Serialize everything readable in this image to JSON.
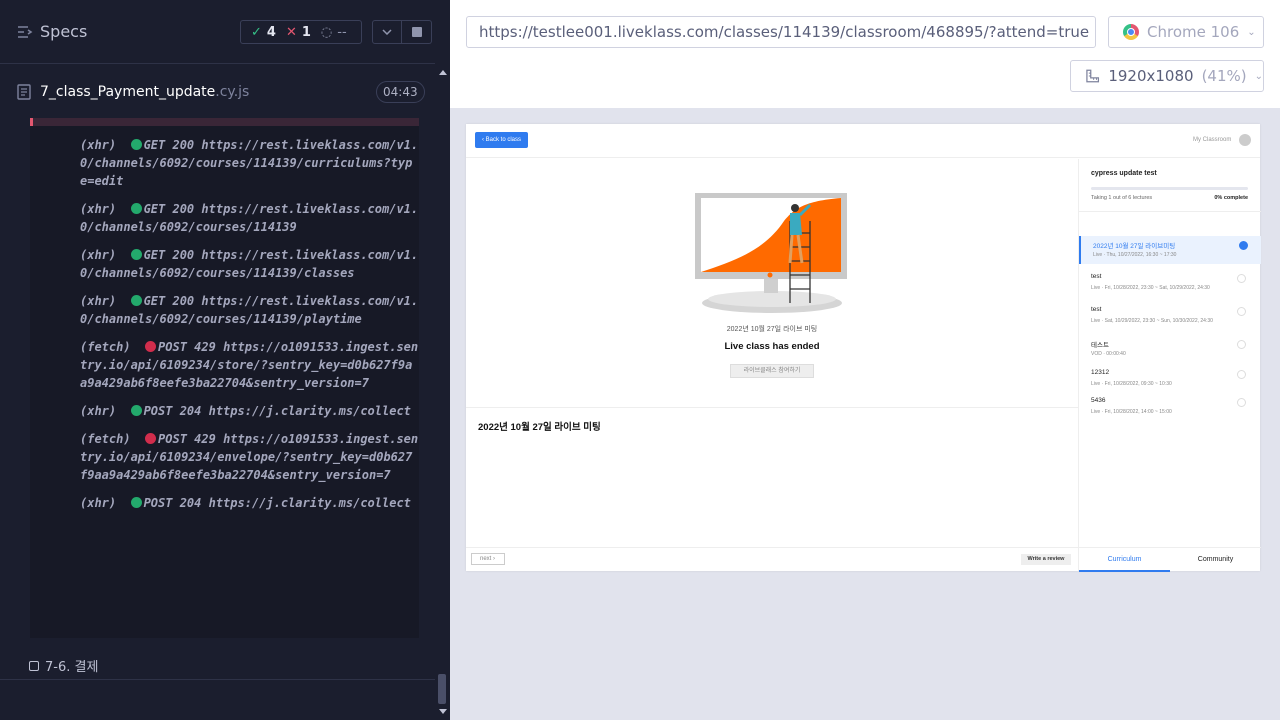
{
  "runner": {
    "specs_title": "Specs",
    "stats": {
      "passed": "4",
      "failed": "1",
      "pending": "--"
    },
    "file": {
      "name": "7_class_Payment_update",
      "ext": ".cy.js",
      "time": "04:43"
    },
    "log": [
      {
        "kind": "(xhr)",
        "status": "ok",
        "method": "GET 200",
        "url": "https://rest.liveklass.com/v1.0/channels/6092/courses/114139/curriculums?type=edit"
      },
      {
        "kind": "(xhr)",
        "status": "ok",
        "method": "GET 200",
        "url": "https://rest.liveklass.com/v1.0/channels/6092/courses/114139"
      },
      {
        "kind": "(xhr)",
        "status": "ok",
        "method": "GET 200",
        "url": "https://rest.liveklass.com/v1.0/channels/6092/courses/114139/classes"
      },
      {
        "kind": "(xhr)",
        "status": "ok",
        "method": "GET 200",
        "url": "https://rest.liveklass.com/v1.0/channels/6092/courses/114139/playtime"
      },
      {
        "kind": "(fetch)",
        "status": "err",
        "method": "POST 429",
        "url": "https://o1091533.ingest.sentry.io/api/6109234/store/?sentry_key=d0b627f9aa9a429ab6f8eefe3ba22704&sentry_version=7"
      },
      {
        "kind": "(xhr)",
        "status": "ok",
        "method": "POST 204",
        "url": "https://j.clarity.ms/collect"
      },
      {
        "kind": "(fetch)",
        "status": "err",
        "method": "POST 429",
        "url": "https://o1091533.ingest.sentry.io/api/6109234/envelope/?sentry_key=d0b627f9aa9a429ab6f8eefe3ba22704&sentry_version=7"
      },
      {
        "kind": "(xhr)",
        "status": "ok",
        "method": "POST 204",
        "url": "https://j.clarity.ms/collect"
      }
    ],
    "test_title": "7-6. 결제"
  },
  "browser": {
    "url": "https://testlee001.liveklass.com/classes/114139/classroom/468895/?attend=true",
    "name": "Chrome 106",
    "viewport": "1920x1080",
    "zoom": "(41%)"
  },
  "app": {
    "back_label": "Back to class",
    "my_classroom": "My Classroom",
    "ended_sub": "2022년 10월 27일 라이브 미팅",
    "ended_title": "Live class has ended",
    "join_label": "라이브클래스 참여하기",
    "lecture_title": "2022년 10월 27일 라이브 미팅",
    "next_label": "next",
    "review_label": "Write a review",
    "course_name": "cypress update test",
    "taking": "Taking 1 out of 6 lectures",
    "percent": "0% complete",
    "lectures": [
      {
        "title": "2022년 10월 27일 라이브미팅",
        "meta": "Live  ·  Thu, 10/27/2022, 16:30 ~ 17:30"
      },
      {
        "title": "test",
        "meta": "Live  ·  Fri, 10/28/2022, 23:30 ~ Sat, 10/29/2022, 24:30"
      },
      {
        "title": "test",
        "meta": "Live  ·  Sat, 10/29/2022, 23:30 ~ Sun, 10/30/2022, 24:30"
      },
      {
        "title": "테스트",
        "meta": "VOD  ·  00:00:40"
      },
      {
        "title": "12312",
        "meta": "Live  ·  Fri, 10/28/2022, 09:30 ~ 10:30"
      },
      {
        "title": "5436",
        "meta": "Live  ·  Fri, 10/28/2022, 14:00 ~ 15:00"
      }
    ],
    "tab_curriculum": "Curriculum",
    "tab_community": "Community",
    "colors": {
      "accent": "#2f7bef",
      "illustration": "#ff6a00"
    }
  }
}
